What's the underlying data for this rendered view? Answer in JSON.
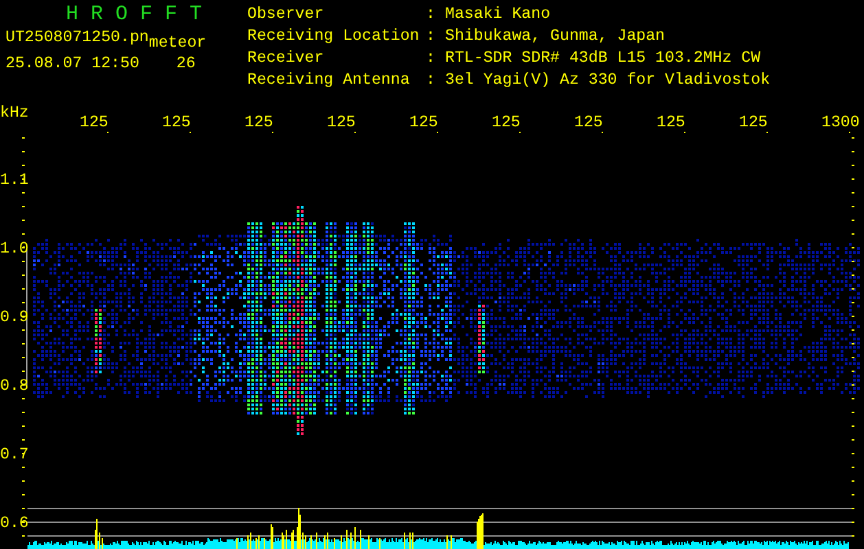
{
  "header": {
    "title": "H R O F F T",
    "file_name": "UT2508071250.pn",
    "category": "meteor",
    "date_time": "25.08.07 12:50",
    "count": "26"
  },
  "info": [
    {
      "label": "Observer",
      "separator": ":",
      "value": "Masaki Kano"
    },
    {
      "label": "Receiving Location",
      "separator": ":",
      "value": "Shibukawa, Gunma, Japan"
    },
    {
      "label": "Receiver",
      "separator": ":",
      "value": "RTL-SDR SDR# 43dB L15 103.2MHz CW"
    },
    {
      "label": "Receiving Antenna",
      "separator": ":",
      "value": "3el Yagi(V) Az 330 for Vladivostok"
    }
  ],
  "plot": {
    "unit": "kHz",
    "x_labels": [
      "125",
      "125",
      "125",
      "125",
      "125",
      "125",
      "125",
      "125",
      "125",
      "1300"
    ],
    "y_labels": [
      "1.1",
      "1.0",
      "0.9",
      "0.8",
      "0.7",
      "0.6"
    ]
  }
}
